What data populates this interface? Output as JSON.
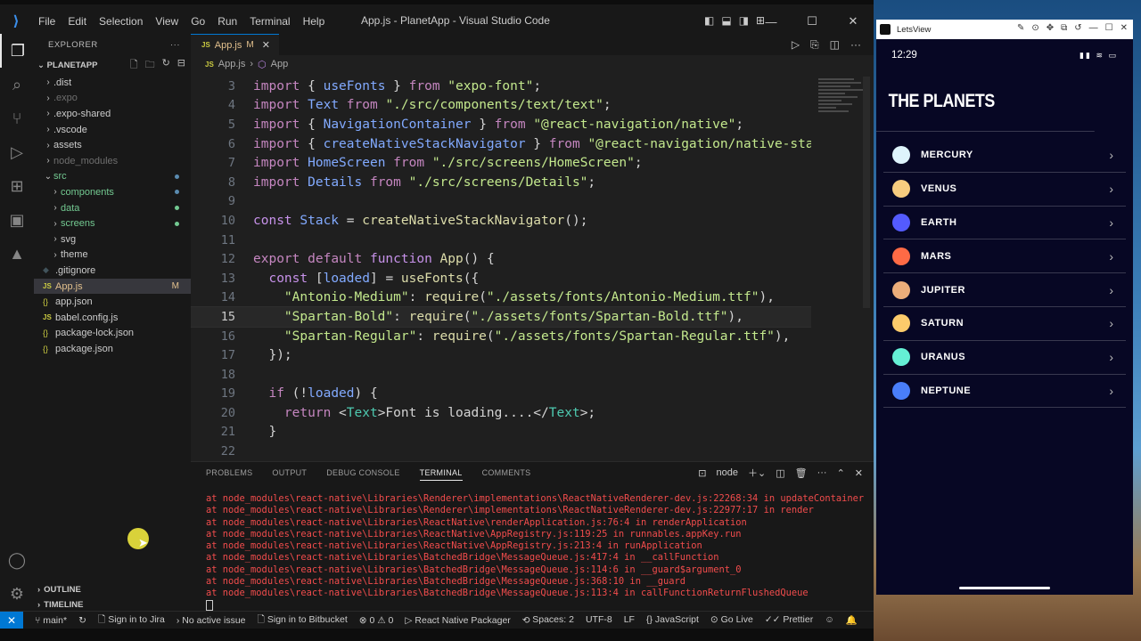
{
  "menu": [
    "File",
    "Edit",
    "Selection",
    "View",
    "Go",
    "Run",
    "Terminal",
    "Help"
  ],
  "window_title": "App.js - PlanetApp - Visual Studio Code",
  "explorer": {
    "title": "EXPLORER",
    "project": "PLANETAPP",
    "tree": [
      {
        "label": ".dist",
        "kind": "folder-closed",
        "indent": 0
      },
      {
        "label": ".expo",
        "kind": "folder-closed",
        "indent": 0,
        "style": "dim"
      },
      {
        "label": ".expo-shared",
        "kind": "folder-closed",
        "indent": 0
      },
      {
        "label": ".vscode",
        "kind": "folder-closed",
        "indent": 0
      },
      {
        "label": "assets",
        "kind": "folder-closed",
        "indent": 0
      },
      {
        "label": "node_modules",
        "kind": "folder-closed",
        "indent": 0,
        "style": "dim"
      },
      {
        "label": "src",
        "kind": "folder-open",
        "indent": 0,
        "style": "green"
      },
      {
        "label": "components",
        "kind": "folder-closed",
        "indent": 1,
        "style": "green"
      },
      {
        "label": "data",
        "kind": "folder-closed",
        "indent": 1,
        "style": "green"
      },
      {
        "label": "screens",
        "kind": "folder-closed",
        "indent": 1,
        "style": "green"
      },
      {
        "label": "svg",
        "kind": "folder-closed",
        "indent": 1
      },
      {
        "label": "theme",
        "kind": "folder-closed",
        "indent": 1
      },
      {
        "label": ".gitignore",
        "kind": "file-git",
        "indent": 0
      },
      {
        "label": "App.js",
        "kind": "file-js",
        "indent": 0,
        "style": "selected",
        "mark": "M"
      },
      {
        "label": "app.json",
        "kind": "file-json",
        "indent": 0
      },
      {
        "label": "babel.config.js",
        "kind": "file-js",
        "indent": 0
      },
      {
        "label": "package-lock.json",
        "kind": "file-json",
        "indent": 0
      },
      {
        "label": "package.json",
        "kind": "file-json",
        "indent": 0
      }
    ],
    "outline": "OUTLINE",
    "timeline": "TIMELINE"
  },
  "tab": {
    "name": "App.js",
    "modified": "M"
  },
  "breadcrumb": {
    "file": "App.js",
    "symbol": "App"
  },
  "code_lines": [
    {
      "n": "3",
      "html": "<span class='k'>import</span> { <span class='v'>useFonts</span> } <span class='k'>from</span> <span class='s'>\"expo-font\"</span>;"
    },
    {
      "n": "4",
      "html": "<span class='k'>import</span> <span class='v'>Text</span> <span class='k'>from</span> <span class='s'>\"./src/components/text/text\"</span>;"
    },
    {
      "n": "5",
      "html": "<span class='k'>import</span> { <span class='v'>NavigationContainer</span> } <span class='k'>from</span> <span class='s'>\"@react-navigation/native\"</span>;"
    },
    {
      "n": "6",
      "html": "<span class='k'>import</span> { <span class='v'>createNativeStackNavigator</span> } <span class='k'>from</span> <span class='s'>\"@react-navigation/native-sta</span>"
    },
    {
      "n": "7",
      "html": "<span class='k'>import</span> <span class='v'>HomeScreen</span> <span class='k'>from</span> <span class='s'>\"./src/screens/HomeScreen\"</span>;"
    },
    {
      "n": "8",
      "html": "<span class='k'>import</span> <span class='v'>Details</span> <span class='k'>from</span> <span class='s'>\"./src/screens/Details\"</span>;"
    },
    {
      "n": "9",
      "html": ""
    },
    {
      "n": "10",
      "html": "<span class='kw'>const</span> <span class='v'>Stack</span> = <span class='f'>createNativeStackNavigator</span>();"
    },
    {
      "n": "11",
      "html": ""
    },
    {
      "n": "12",
      "html": "<span class='k'>export</span> <span class='k'>default</span> <span class='kw'>function</span> <span class='f'>App</span>() {"
    },
    {
      "n": "13",
      "html": "  <span class='kw'>const</span> [<span class='v'>loaded</span>] = <span class='f'>useFonts</span>({"
    },
    {
      "n": "14",
      "html": "    <span class='s'>\"Antonio-Medium\"</span>: <span class='f'>require</span>(<span class='s'>\"./assets/fonts/Antonio-Medium.ttf\"</span>),"
    },
    {
      "n": "15",
      "html": "    <span class='s'>\"Spartan-Bold\"</span>: <span class='f'>require</span>(<span class='s'>\"./assets/fonts/Spartan-Bold.ttf\"</span>),",
      "current": true
    },
    {
      "n": "16",
      "html": "    <span class='s'>\"Spartan-Regular\"</span>: <span class='f'>require</span>(<span class='s'>\"./assets/fonts/Spartan-Regular.ttf\"</span>),"
    },
    {
      "n": "17",
      "html": "  });"
    },
    {
      "n": "18",
      "html": ""
    },
    {
      "n": "19",
      "html": "  <span class='k'>if</span> (!<span class='v'>loaded</span>) {"
    },
    {
      "n": "20",
      "html": "    <span class='k'>return</span> &lt;<span class='t'>Text</span>&gt;Font is loading....&lt;/<span class='t'>Text</span>&gt;;"
    },
    {
      "n": "21",
      "html": "  }"
    },
    {
      "n": "22",
      "html": ""
    }
  ],
  "panel": {
    "tabs": [
      "PROBLEMS",
      "OUTPUT",
      "DEBUG CONSOLE",
      "TERMINAL",
      "COMMENTS"
    ],
    "active_tab": "TERMINAL",
    "shell": "node",
    "terminal_lines": [
      "at node_modules\\react-native\\Libraries\\Renderer\\implementations\\ReactNativeRenderer-dev.js:22268:34 in updateContainer",
      "at node_modules\\react-native\\Libraries\\Renderer\\implementations\\ReactNativeRenderer-dev.js:22977:17 in render",
      "at node_modules\\react-native\\Libraries\\ReactNative\\renderApplication.js:76:4 in renderApplication",
      "at node_modules\\react-native\\Libraries\\ReactNative\\AppRegistry.js:119:25 in runnables.appKey.run",
      "at node_modules\\react-native\\Libraries\\ReactNative\\AppRegistry.js:213:4 in runApplication",
      "at node_modules\\react-native\\Libraries\\BatchedBridge\\MessageQueue.js:417:4 in __callFunction",
      "at node_modules\\react-native\\Libraries\\BatchedBridge\\MessageQueue.js:114:6 in __guard$argument_0",
      "at node_modules\\react-native\\Libraries\\BatchedBridge\\MessageQueue.js:368:10 in __guard",
      "at node_modules\\react-native\\Libraries\\BatchedBridge\\MessageQueue.js:113:4 in callFunctionReturnFlushedQueue"
    ]
  },
  "status": {
    "branch": "main*",
    "jira": "Sign in to Jira",
    "issue": "No active issue",
    "bitbucket": "Sign in to Bitbucket",
    "problems": "⊗ 0 ⚠ 0",
    "packager": "React Native Packager",
    "spaces": "Spaces: 2",
    "encoding": "UTF-8",
    "eol": "LF",
    "language": "{} JavaScript",
    "golive": "Go Live",
    "prettier": "Prettier"
  },
  "letsview": {
    "title": "LetsView",
    "time": "12:29",
    "header": "THE PLANETS",
    "planets": [
      {
        "name": "MERCURY",
        "color": "#DEF4FC"
      },
      {
        "name": "VENUS",
        "color": "#F7CC7F"
      },
      {
        "name": "EARTH",
        "color": "#545BFE"
      },
      {
        "name": "MARS",
        "color": "#FF6A45"
      },
      {
        "name": "JUPITER",
        "color": "#ECAD7A"
      },
      {
        "name": "SATURN",
        "color": "#FCCB6B"
      },
      {
        "name": "URANUS",
        "color": "#65F0D5"
      },
      {
        "name": "NEPTUNE",
        "color": "#497EFA"
      }
    ]
  }
}
